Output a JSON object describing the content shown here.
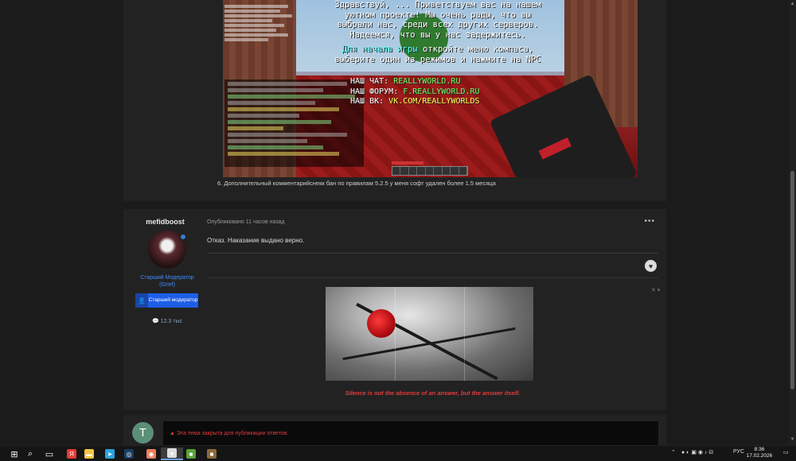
{
  "post1": {
    "mc_screenshot": {
      "welcome_lines": [
        "Здравствуй, ... Приветствуем вас на нашем",
        "уютном проекте! Мы очень рады, что вы",
        "выбрали нас, среди всех других серверов.",
        "Надеемся, что вы у нас задержитесь."
      ],
      "compass_line_1_a": "Для начала игры",
      "compass_line_1_b": " откройте меню компаса,",
      "compass_line_2": "выберите один из режимов и нажмите на NPC",
      "chat_label": "НАШ ЧАТ: ",
      "chat_value": "REALLYWORLD.RU",
      "forum_label": "НАШ ФОРУМ: ",
      "forum_value": "F.REALLYWORLD.RU",
      "vk_label": "НАШ ВК: ",
      "vk_value": "VK.COM/REALLYWORLDS"
    },
    "comment": "6. Дополнительный комментарийснекк бан по правилам 5.2.5 у меня софт удален более 1.5 месяца"
  },
  "post2": {
    "author": {
      "name": "mefidboost",
      "rank_text": "Старший Модератор (Grief)",
      "rank_badge": "Старший модератор",
      "rank_badge_icon": "user-icon",
      "reputation": "12.3 тыс"
    },
    "meta": "Опубликовано 11 часов назад",
    "menu": "•••",
    "text": "Отказ. Наказание выдано верно.",
    "like_icon": "heart-icon",
    "image_controls": "✕ ▾",
    "signature": "Silence is not the absence of an answer, but the answer itself."
  },
  "closed": {
    "avatar_letter": "T",
    "avatar_color": "#5b8f78",
    "notice": "▲ Эта тема закрыта для публикации ответов."
  },
  "taskbar": {
    "items": [
      {
        "icon": "windows-start-icon",
        "glyph": "⊞",
        "color": "#ffffff"
      },
      {
        "icon": "search-icon",
        "glyph": "⌕",
        "color": "#ffffff"
      },
      {
        "icon": "task-view-icon",
        "glyph": "▭",
        "color": "#ffffff"
      },
      {
        "icon": "yandex-browser-icon",
        "glyph": "Я",
        "color": "#e53935"
      },
      {
        "icon": "file-explorer-icon",
        "glyph": "▬",
        "color": "#f4c542"
      },
      {
        "icon": "telegram-icon",
        "glyph": "➤",
        "color": "#2aa3e0"
      },
      {
        "icon": "steam-icon",
        "glyph": "◎",
        "color": "#1b3c60"
      },
      {
        "icon": "app-icon",
        "glyph": "◉",
        "color": "#ef7d57"
      },
      {
        "icon": "launcher-icon",
        "glyph": "●",
        "color": "#dddddd"
      },
      {
        "icon": "minecraft-icon",
        "glyph": "■",
        "color": "#5aa13a"
      },
      {
        "icon": "minecraft-launcher-icon",
        "glyph": "■",
        "color": "#8a6a3c"
      }
    ],
    "language": "РУС",
    "time": "8:36",
    "date": "17.02.2026"
  }
}
